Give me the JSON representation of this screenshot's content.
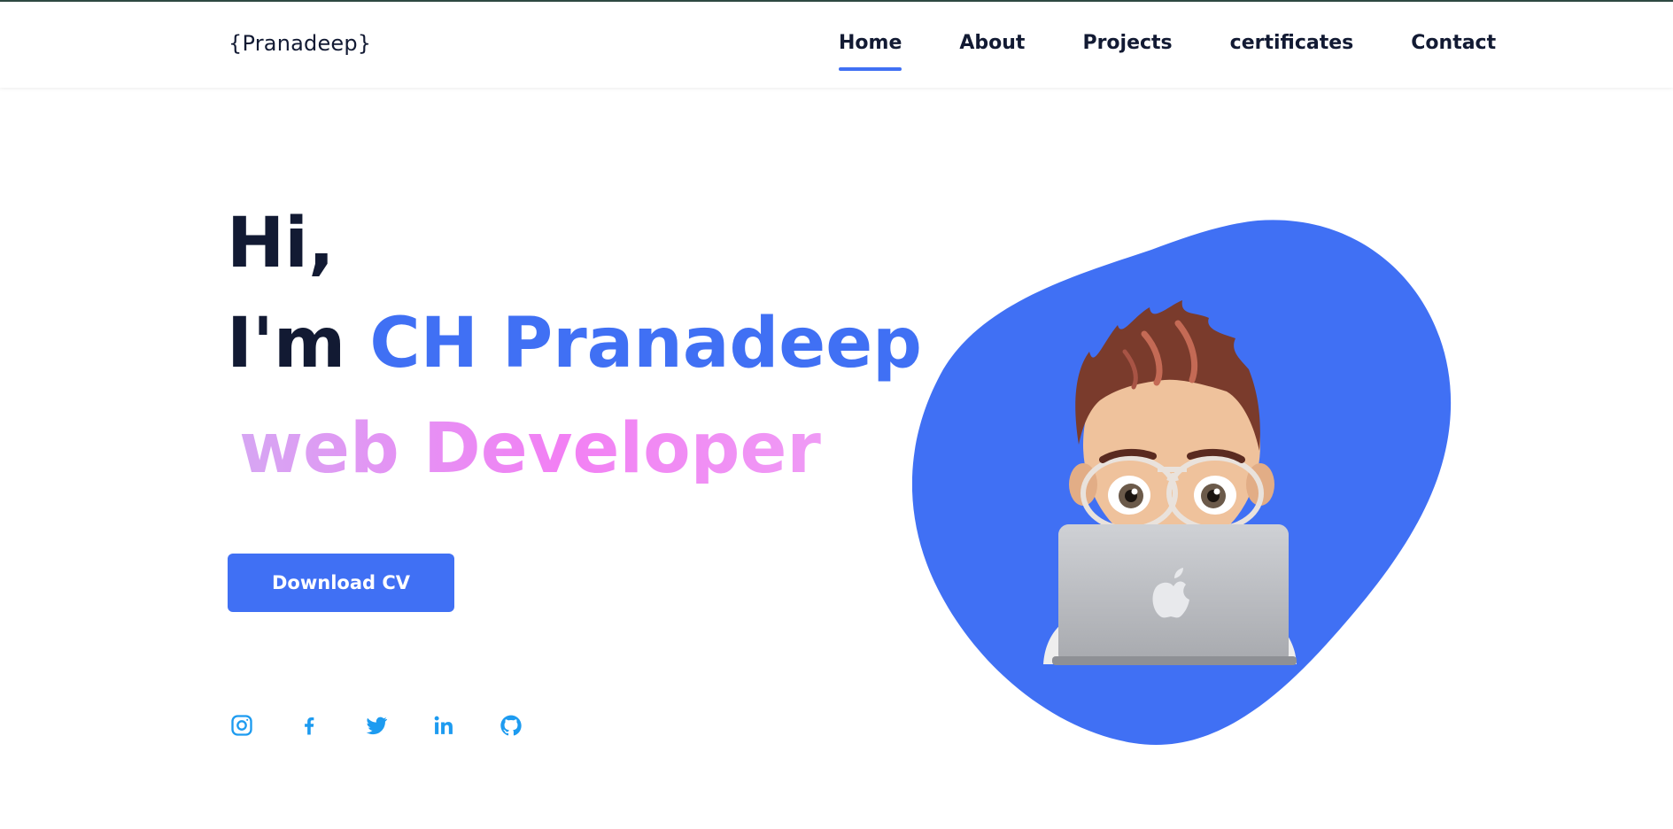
{
  "header": {
    "logo": "{Pranadeep}",
    "nav": [
      {
        "label": "Home",
        "active": true
      },
      {
        "label": "About",
        "active": false
      },
      {
        "label": "Projects",
        "active": false
      },
      {
        "label": "certificates",
        "active": false
      },
      {
        "label": "Contact",
        "active": false
      }
    ]
  },
  "hero": {
    "greeting": "Hi,",
    "intro_prefix": "I'm",
    "name": "CH Pranadeep",
    "role": " web Developer",
    "cta_label": "Download CV"
  },
  "socials": [
    {
      "icon": "instagram-icon"
    },
    {
      "icon": "facebook-icon"
    },
    {
      "icon": "twitter-icon"
    },
    {
      "icon": "linkedin-icon"
    },
    {
      "icon": "github-icon"
    }
  ],
  "colors": {
    "accent": "#4070f4",
    "heading": "#121a33",
    "role_gradient_start": "#d6a6f3",
    "role_gradient_end": "#f280f4",
    "social_icon": "#1d9bf0"
  }
}
